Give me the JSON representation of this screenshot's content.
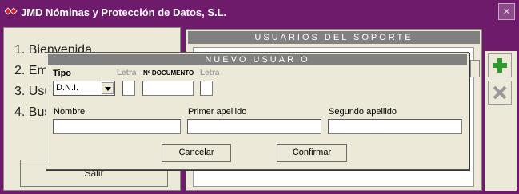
{
  "window": {
    "title": "JMD Nóminas y Protección de Datos, S.L.",
    "close_label": "×"
  },
  "left_menu": {
    "items": [
      "1. Bienvenida",
      "2. Em",
      "3. Usu",
      "4. Bus"
    ],
    "exit_label": "Salir"
  },
  "support_panel": {
    "header": "USUARIOS DEL SOPORTE"
  },
  "dialog": {
    "title": "NUEVO USUARIO",
    "tipo_label": "Tipo",
    "tipo_value": "D.N.I.",
    "letra_label_1": "Letra",
    "documento_label": "Nº DOCUMENTO",
    "letra_label_2": "Letra",
    "nombre_label": "Nombre",
    "primer_apellido_label": "Primer apellido",
    "segundo_apellido_label": "Segundo apellido",
    "cancel_label": "Cancelar",
    "confirm_label": "Confirmar"
  },
  "icons": {
    "title_icon": "red-diamond-icon",
    "add_icon": "green-plus-icon",
    "delete_icon": "gray-x-icon"
  },
  "colors": {
    "frame": "#6e1b6b",
    "panel": "#ece9d8",
    "header_bar": "#808080",
    "add_green": "#2e9a2e"
  }
}
